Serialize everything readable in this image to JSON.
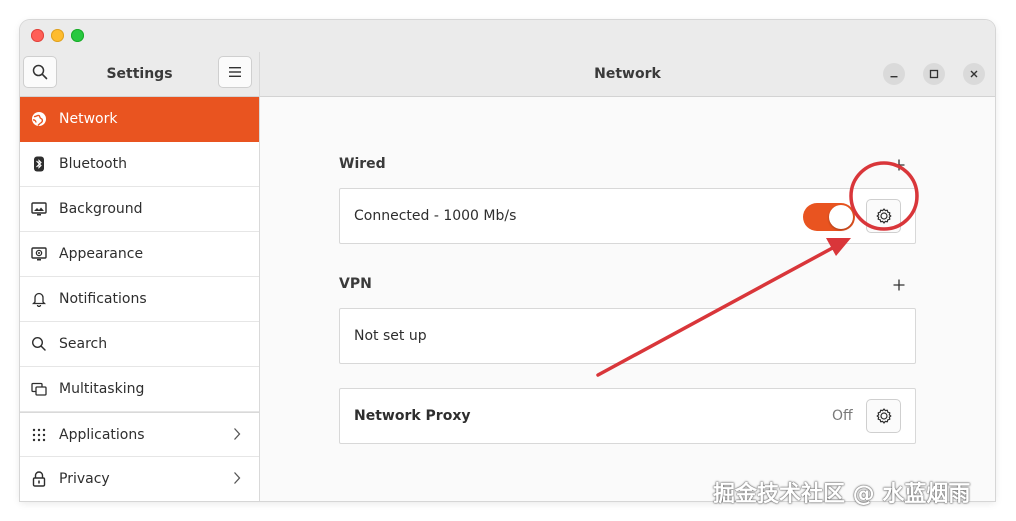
{
  "sidebar": {
    "title": "Settings",
    "items": [
      {
        "label": "Network",
        "icon": "network-icon",
        "active": true
      },
      {
        "label": "Bluetooth",
        "icon": "bluetooth-icon"
      },
      {
        "label": "Background",
        "icon": "background-icon"
      },
      {
        "label": "Appearance",
        "icon": "appearance-icon"
      },
      {
        "label": "Notifications",
        "icon": "notifications-icon"
      },
      {
        "label": "Search",
        "icon": "search-icon"
      },
      {
        "label": "Multitasking",
        "icon": "multitasking-icon"
      },
      {
        "label": "Applications",
        "icon": "applications-icon",
        "has_submenu": true
      },
      {
        "label": "Privacy",
        "icon": "privacy-icon",
        "has_submenu": true
      }
    ]
  },
  "main": {
    "title": "Network",
    "wired": {
      "label": "Wired",
      "status": "Connected - 1000 Mb/s",
      "enabled": true
    },
    "vpn": {
      "label": "VPN",
      "status": "Not set up"
    },
    "proxy": {
      "label": "Network Proxy",
      "status": "Off"
    }
  },
  "colors": {
    "accent": "#e95420",
    "annotation": "#d9363a"
  },
  "watermark": "掘金技术社区 @ 水蓝烟雨"
}
